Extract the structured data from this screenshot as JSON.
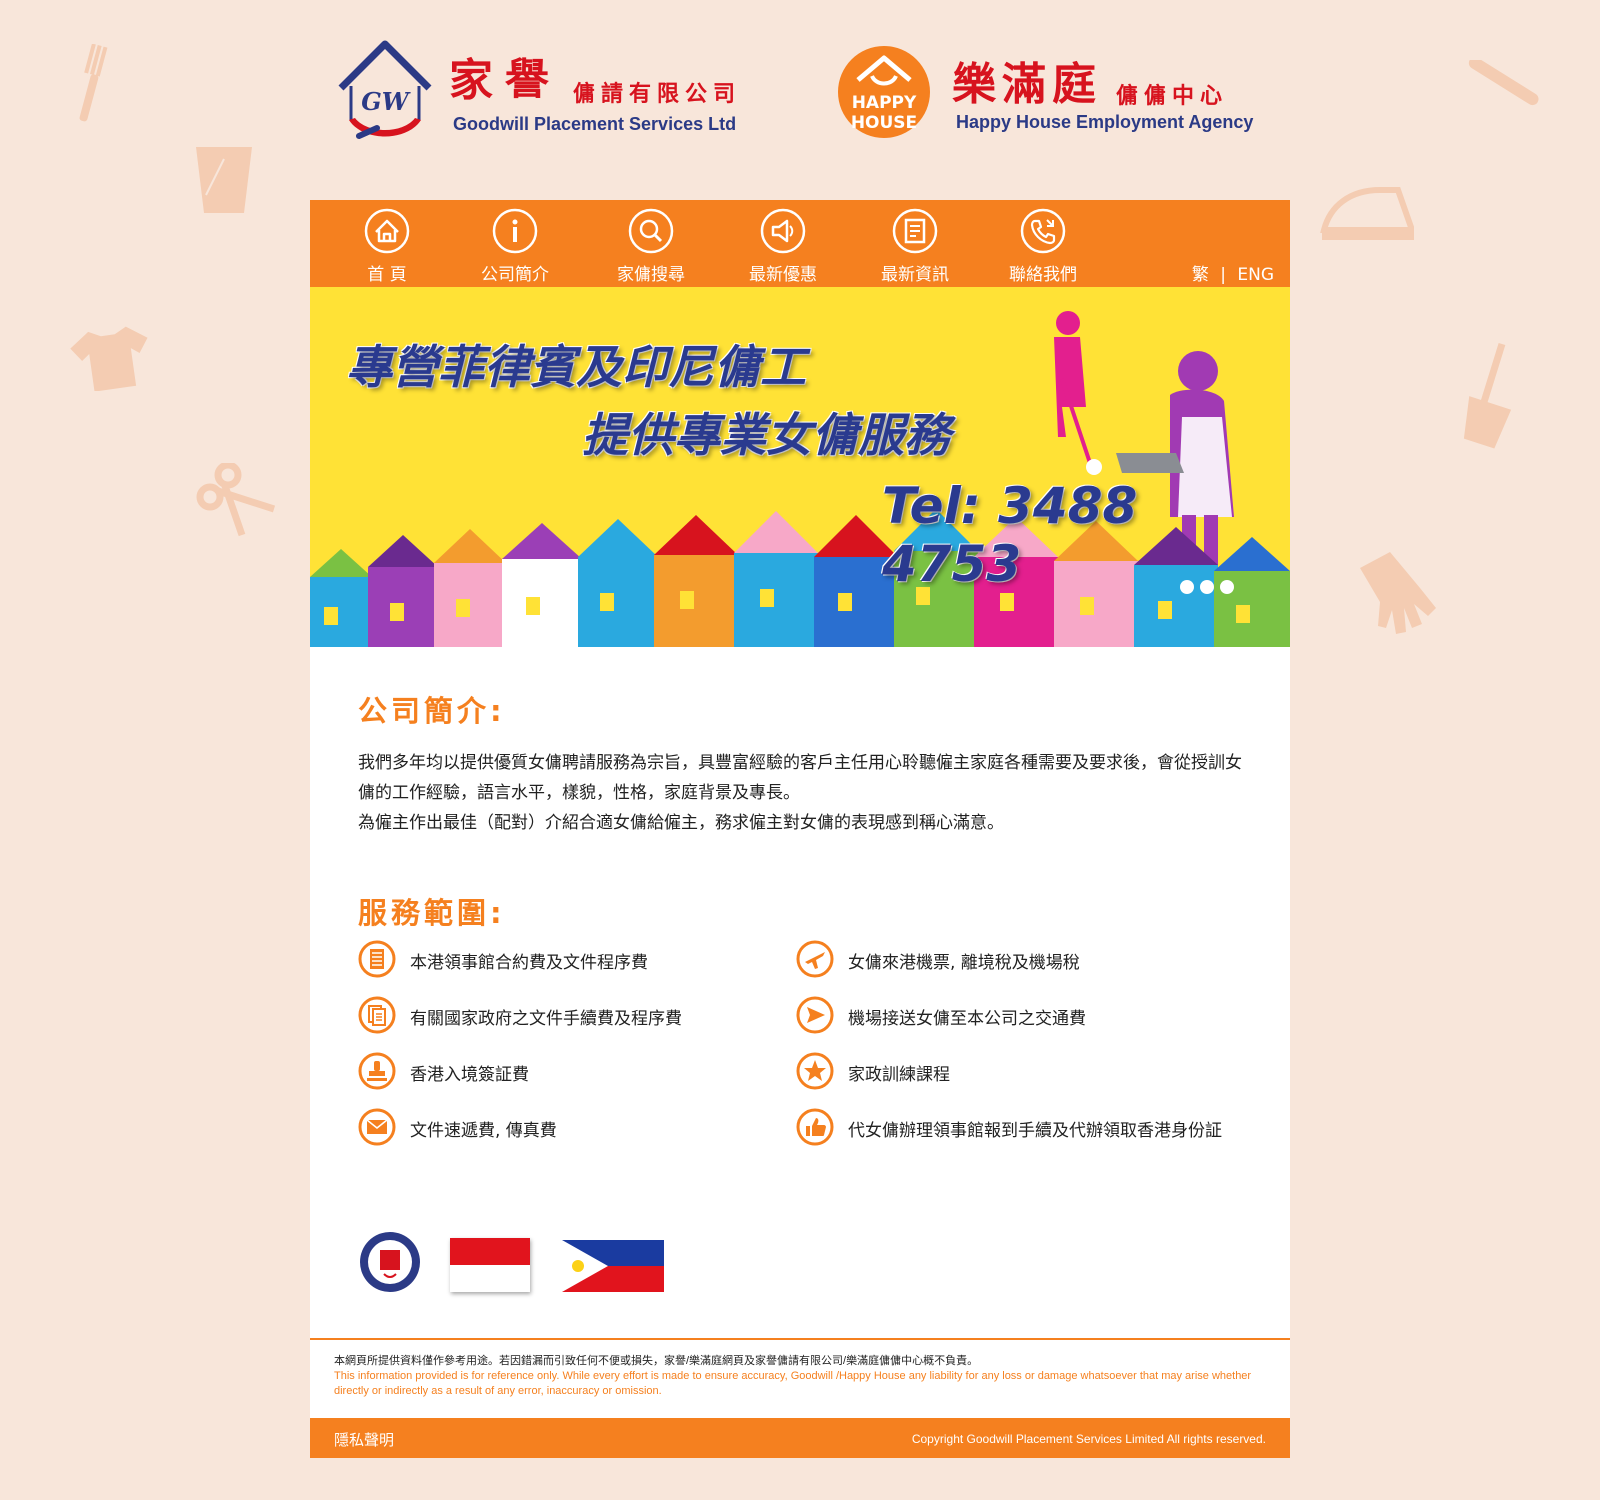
{
  "brand": {
    "goodwill": {
      "mark": "GW",
      "name_cn": "家譽",
      "suffix_cn": "傭請有限公司",
      "name_en": "Goodwill Placement Services Ltd"
    },
    "happy_house": {
      "mark_line1": "HAPPY",
      "mark_line2": "HOUSE",
      "name_cn": "樂滿庭",
      "suffix_cn": "傭傭中心",
      "name_en": "Happy House Employment Agency"
    }
  },
  "nav": {
    "items": [
      {
        "label": "首 頁",
        "icon": "home-icon"
      },
      {
        "label": "公司簡介",
        "icon": "info-icon"
      },
      {
        "label": "家傭搜尋",
        "icon": "search-icon"
      },
      {
        "label": "最新優惠",
        "icon": "speaker-icon"
      },
      {
        "label": "最新資訊",
        "icon": "news-icon"
      },
      {
        "label": "聯絡我們",
        "icon": "phone-icon"
      }
    ],
    "lang_trad": "繁",
    "lang_sep": "|",
    "lang_eng": "ENG"
  },
  "banner": {
    "line1": "專營菲律賓及印尼傭工",
    "line2": "提供專業女傭服務",
    "tel": "Tel: 3488 4753"
  },
  "about": {
    "title": "公司簡介:",
    "paragraph1": "我們多年均以提供優質女傭聘請服務為宗旨，具豐富經驗的客戶主任用心聆聽僱主家庭各種需要及要求後，會從授訓女傭的工作經驗，語言水平，樣貌，性格，家庭背景及專長。",
    "paragraph2": "為僱主作出最佳（配對）介紹合適女傭給僱主，務求僱主對女傭的表現感到稱心滿意。"
  },
  "services": {
    "title": "服務範圍:",
    "left": [
      {
        "text": "本港領事館合約費及文件程序費",
        "icon": "document-list-icon"
      },
      {
        "text": "有關國家政府之文件手續費及程序費",
        "icon": "documents-icon"
      },
      {
        "text": "香港入境簽証費",
        "icon": "stamp-icon"
      },
      {
        "text": "文件速遞費, 傳真費",
        "icon": "envelope-icon"
      }
    ],
    "right": [
      {
        "text": "女傭來港機票, 離境稅及機場稅",
        "icon": "airplane-icon"
      },
      {
        "text": "機場接送女傭至本公司之交通費",
        "icon": "send-icon"
      },
      {
        "text": "家政訓練課程",
        "icon": "star-icon"
      },
      {
        "text": "代女傭辦理領事館報到手續及代辦領取香港身份証",
        "icon": "thumbs-up-icon"
      }
    ]
  },
  "footer": {
    "disclaimer_cn": "本網頁所提供資料僅作參考用途。若因錯漏而引致任何不便或損失，家譽/樂滿庭網頁及家譽傭請有限公司/樂滿庭傭傭中心概不負責。",
    "disclaimer_en": "This information provided is for reference only. While every effort is made to ensure accuracy, Goodwill /Happy House any liability for any loss or damage whatsoever that may arise whether directly or indirectly as a result of any error, inaccuracy or omission.",
    "privacy": "隱私聲明",
    "copyright": "Copyright Goodwill Placement Services Limited All rights reserved."
  },
  "colors": {
    "accent": "#f5801f",
    "brand_red": "#d7131e",
    "brand_navy": "#2b3a86",
    "banner_yellow": "#ffe236",
    "page_bg": "#f8e6da"
  }
}
